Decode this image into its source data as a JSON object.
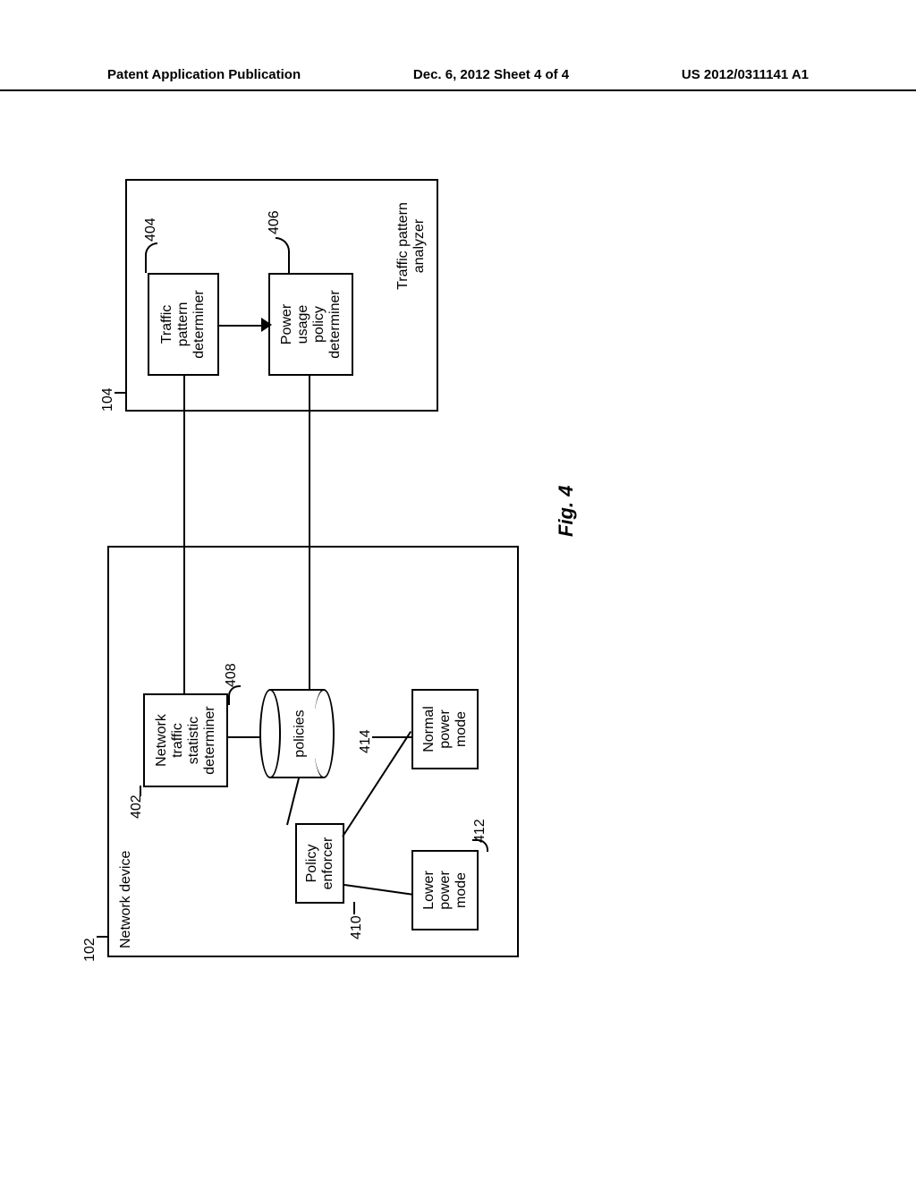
{
  "header": {
    "left": "Patent Application Publication",
    "center": "Dec. 6, 2012   Sheet 4 of 4",
    "right": "US 2012/0311141 A1"
  },
  "refs": {
    "r102": "102",
    "r104": "104",
    "r402": "402",
    "r404": "404",
    "r406": "406",
    "r408": "408",
    "r410": "410",
    "r412": "412",
    "r414": "414"
  },
  "labels": {
    "network_device": "Network device",
    "traffic_pattern_analyzer": "Traffic pattern analyzer"
  },
  "boxes": {
    "network_traffic_stat": "Network\ntraffic\nstatistic\ndeterminer",
    "policy_enforcer": "Policy\nenforcer",
    "lower_power": "Lower\npower\nmode",
    "normal_power": "Normal\npower\nmode",
    "policies": "policies",
    "traffic_pattern_det": "Traffic\npattern\ndeterminer",
    "power_usage_policy": "Power\nusage\npolicy\ndeterminer"
  },
  "figure": "Fig. 4"
}
